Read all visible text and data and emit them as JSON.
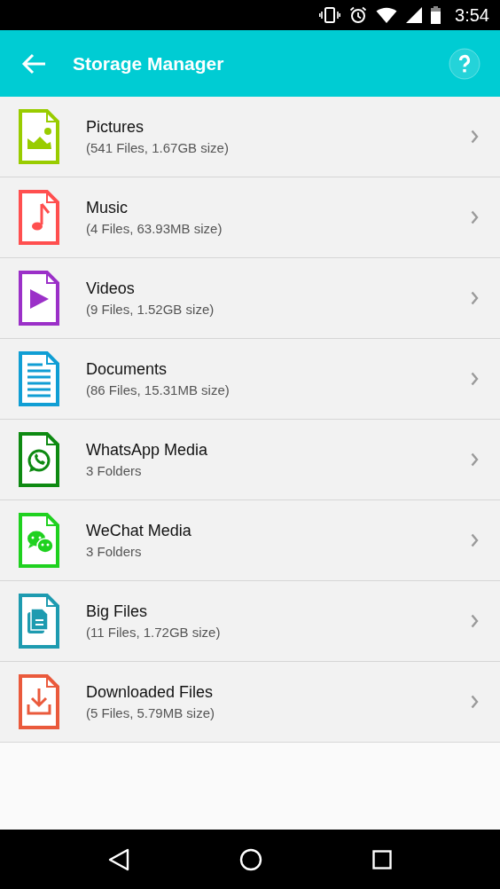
{
  "status_bar": {
    "time": "3:54"
  },
  "app_bar": {
    "title": "Storage Manager"
  },
  "categories": [
    {
      "kind": "picture",
      "color": "#99cc00",
      "name": "Pictures",
      "detail": "(541 Files, 1.67GB size)"
    },
    {
      "kind": "music",
      "color": "#ff4f4f",
      "name": "Music",
      "detail": "(4 Files, 63.93MB size)"
    },
    {
      "kind": "video",
      "color": "#9b30c8",
      "name": "Videos",
      "detail": "(9 Files, 1.52GB size)"
    },
    {
      "kind": "document",
      "color": "#109ed4",
      "name": "Documents",
      "detail": "(86 Files, 15.31MB size)"
    },
    {
      "kind": "whatsapp",
      "color": "#0e8a12",
      "name": "WhatsApp Media",
      "detail": "3 Folders"
    },
    {
      "kind": "wechat",
      "color": "#1fd11f",
      "name": "WeChat Media",
      "detail": "3 Folders"
    },
    {
      "kind": "bigfile",
      "color": "#1e9bb0",
      "name": "Big Files",
      "detail": "(11 Files, 1.72GB size)"
    },
    {
      "kind": "download",
      "color": "#ea5a3c",
      "name": "Downloaded Files",
      "detail": "(5 Files, 5.79MB size)"
    }
  ]
}
